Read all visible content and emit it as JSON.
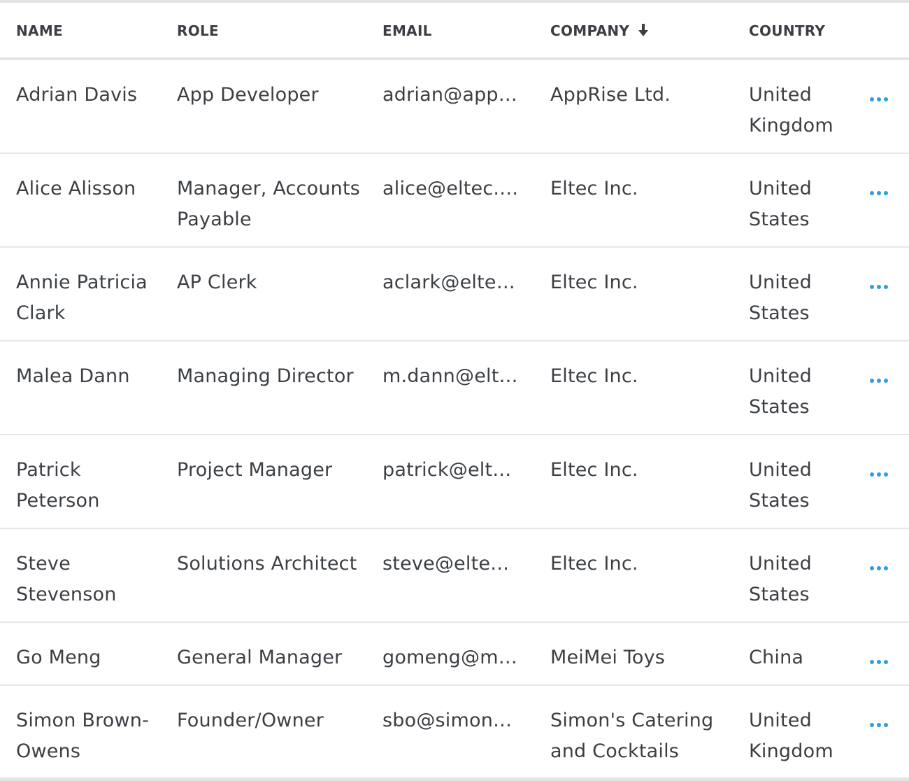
{
  "columns": {
    "name": "NAME",
    "role": "ROLE",
    "email": "EMAIL",
    "company": "COMPANY",
    "country": "COUNTRY"
  },
  "sort": {
    "column": "company",
    "direction": "descending",
    "icon": "arrow-down-icon"
  },
  "actions_icon": "more-horizontal-icon",
  "colors": {
    "text": "#3b3f44",
    "accent": "#2d9ee0",
    "divider": "#e6e7e9"
  },
  "rows": [
    {
      "name": "Adrian Davis",
      "role": "App Developer",
      "email": "adrian@app…",
      "company": "AppRise Ltd.",
      "country": "United Kingdom"
    },
    {
      "name": "Alice Alisson",
      "role": "Manager, Accounts Payable",
      "email": "alice@eltec.c…",
      "company": "Eltec Inc.",
      "country": "United States"
    },
    {
      "name": "Annie Patricia Clark",
      "role": "AP Clerk",
      "email": "aclark@eltec…",
      "company": "Eltec Inc.",
      "country": "United States"
    },
    {
      "name": "Malea Dann",
      "role": "Managing Director",
      "email": "m.dann@elt…",
      "company": "Eltec Inc.",
      "country": "United States"
    },
    {
      "name": "Patrick Peterson",
      "role": "Project Manager",
      "email": "patrick@elte…",
      "company": "Eltec Inc.",
      "country": "United States"
    },
    {
      "name": "Steve Stevenson",
      "role": "Solutions Architect",
      "email": "steve@eltec.…",
      "company": "Eltec Inc.",
      "country": "United States"
    },
    {
      "name": "Go Meng",
      "role": "General Manager",
      "email": "gomeng@m…",
      "company": "MeiMei Toys",
      "country": "China"
    },
    {
      "name": "Simon Brown-Owens",
      "role": "Founder/Owner",
      "email": "sbo@simons…",
      "company": "Simon's Catering and Cocktails",
      "country": "United Kingdom"
    }
  ]
}
